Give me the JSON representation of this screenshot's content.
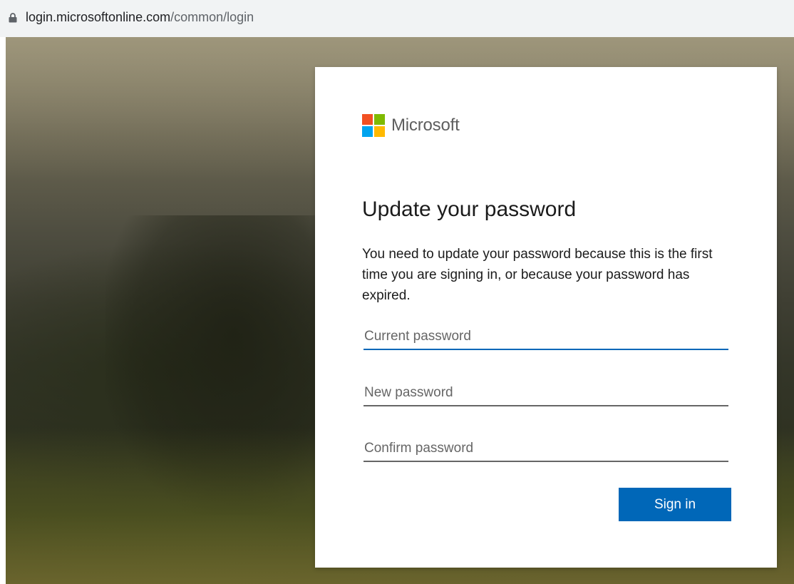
{
  "browser": {
    "url_host": "login.microsoftonline.com",
    "url_path": "/common/login",
    "icons": {
      "lock": "lock-icon"
    }
  },
  "brand": {
    "name": "Microsoft",
    "logo_colors": [
      "#f25022",
      "#7fba00",
      "#00a4ef",
      "#ffb900"
    ]
  },
  "form": {
    "title": "Update your password",
    "description": "You need to update your password because this is the first time you are signing in, or because your password has expired.",
    "current_password": {
      "value": "",
      "placeholder": "Current password",
      "focused": true
    },
    "new_password": {
      "value": "",
      "placeholder": "New password"
    },
    "confirm_password": {
      "value": "",
      "placeholder": "Confirm password"
    },
    "submit_label": "Sign in"
  },
  "colors": {
    "accent": "#0067b8",
    "text": "#1b1b1b",
    "placeholder": "#666666"
  }
}
